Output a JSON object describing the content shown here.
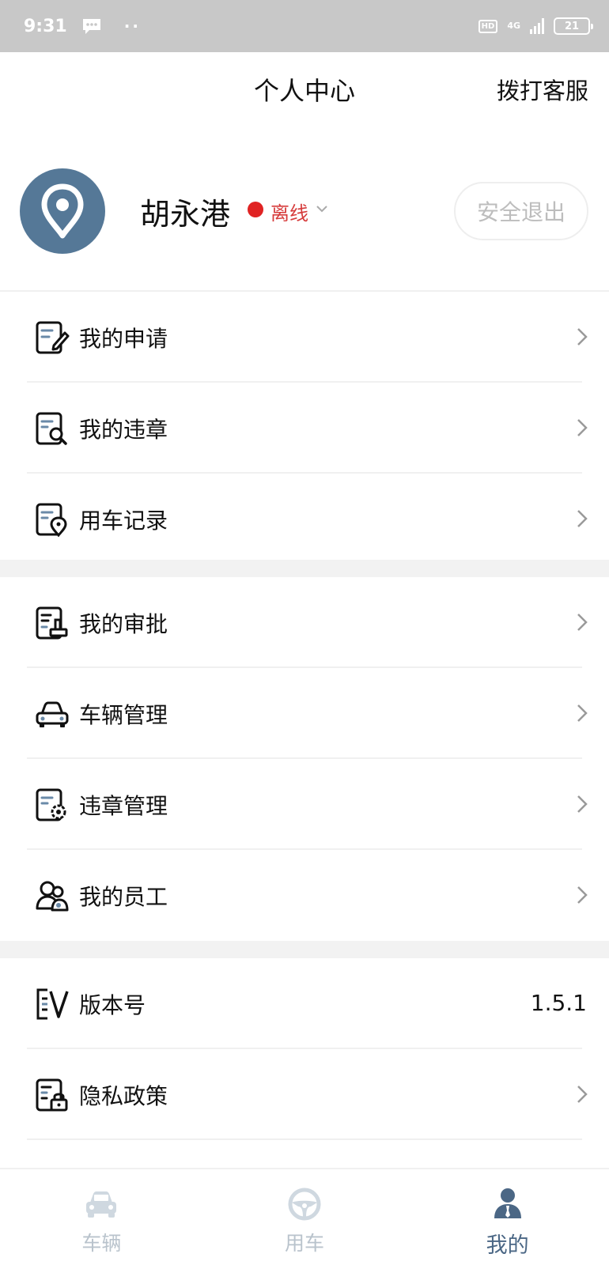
{
  "status_bar": {
    "time": "9:31",
    "dots": "··",
    "hd": "HD",
    "network": "4G",
    "battery": "21"
  },
  "header": {
    "title": "个人中心",
    "call_service": "拨打客服"
  },
  "profile": {
    "name": "胡永港",
    "status": "离线",
    "status_color": "#e02323",
    "logout": "安全退出",
    "avatar_color": "#557897"
  },
  "menu_groups": [
    [
      {
        "label": "我的申请",
        "icon": "application-edit-icon"
      },
      {
        "label": "我的违章",
        "icon": "violation-search-icon"
      },
      {
        "label": "用车记录",
        "icon": "usage-record-location-icon"
      }
    ],
    [
      {
        "label": "我的审批",
        "icon": "approval-stamp-icon"
      },
      {
        "label": "车辆管理",
        "icon": "car-icon"
      },
      {
        "label": "违章管理",
        "icon": "violation-settings-icon"
      },
      {
        "label": "我的员工",
        "icon": "employees-icon"
      }
    ],
    [
      {
        "label": "版本号",
        "icon": "version-icon",
        "value": "1.5.1"
      },
      {
        "label": "隐私政策",
        "icon": "privacy-lock-icon"
      }
    ]
  ],
  "bottom_nav": [
    {
      "label": "车辆",
      "icon": "car-icon",
      "active": false
    },
    {
      "label": "用车",
      "icon": "steering-wheel-icon",
      "active": false
    },
    {
      "label": "我的",
      "icon": "user-icon",
      "active": true
    }
  ],
  "colors": {
    "accent": "#4b6785",
    "icon_accent": "#6a8aa8",
    "inactive_nav": "#b9c3cc"
  }
}
